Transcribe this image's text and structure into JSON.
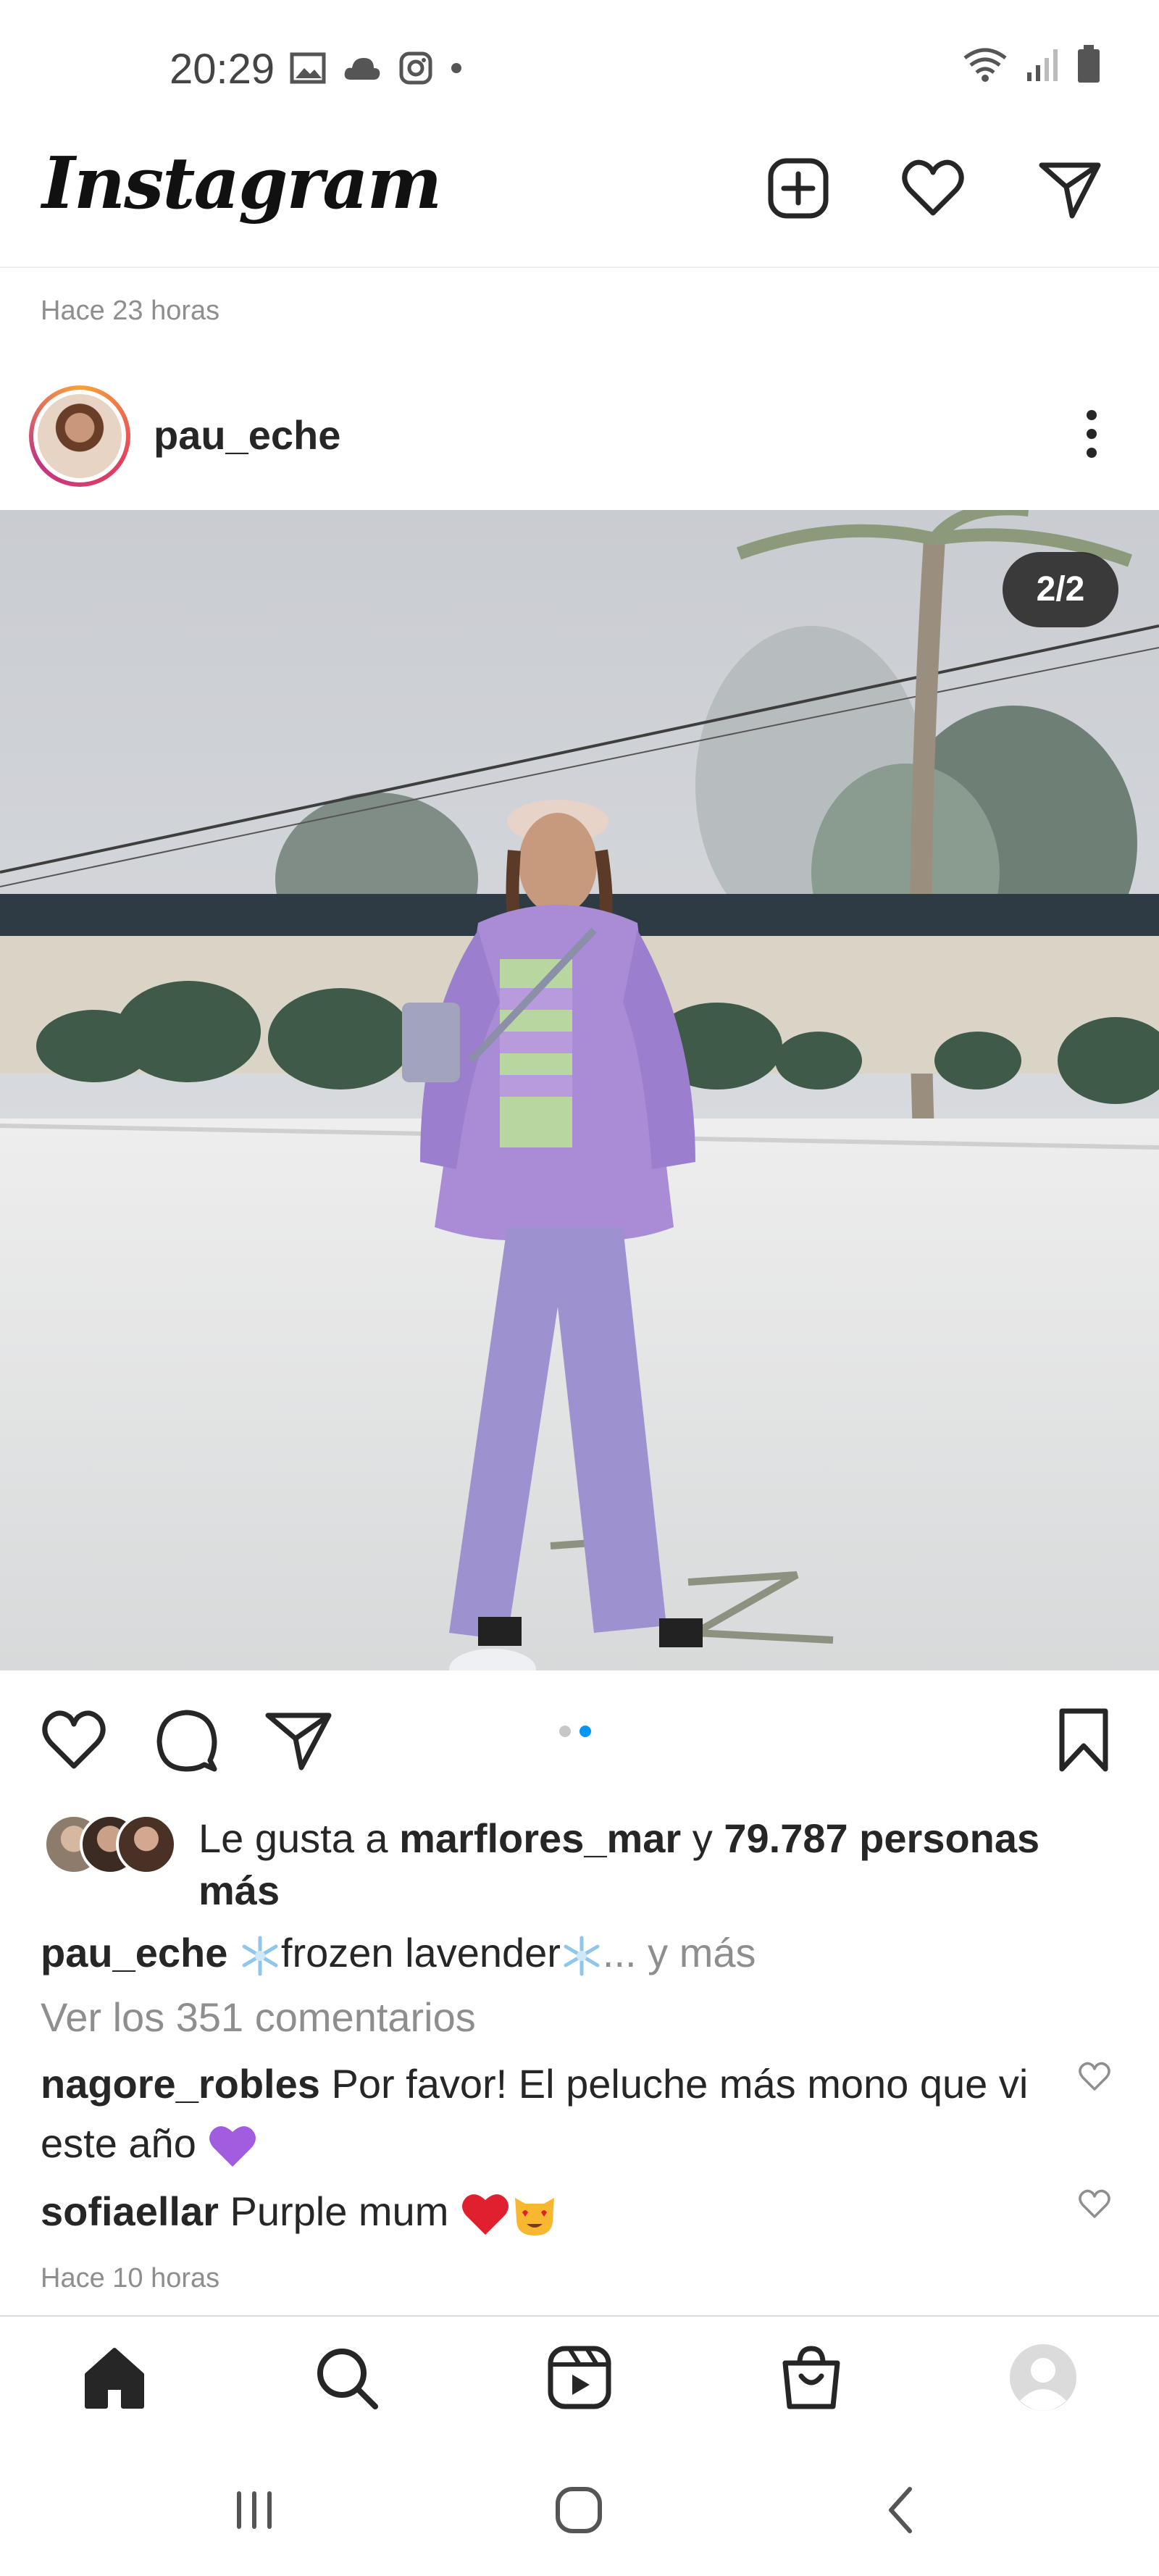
{
  "status_bar": {
    "time": "20:29"
  },
  "header": {
    "logo": "Instagram",
    "icons": [
      "new-post-icon",
      "heart-icon",
      "direct-icon"
    ]
  },
  "previous_post": {
    "time_ago": "Hace 23 horas"
  },
  "post": {
    "username": "pau_eche",
    "carousel_counter": "2/2",
    "carousel_index": 2,
    "carousel_total": 2,
    "likes": {
      "prefix": "Le gusta a ",
      "first_user": "marflores_mar",
      "connector": " y ",
      "others": "79.787 personas más"
    },
    "caption": {
      "username": "pau_eche",
      "text_before": "frozen lavender",
      "more": "... y más"
    },
    "view_comments": "Ver los 351 comentarios",
    "comments": [
      {
        "username": "nagore_robles",
        "text": " Por favor! El peluche más mono que vi este año"
      },
      {
        "username": "sofiaellar",
        "text": " Purple mum"
      }
    ],
    "time_ago": "Hace 10 horas"
  },
  "bottom_nav": {
    "items": [
      "home-icon",
      "search-icon",
      "reels-icon",
      "shop-icon",
      "profile-icon"
    ]
  },
  "colors": {
    "accent_blue": "#0095f6",
    "text": "#262626",
    "muted": "#8e8e8e",
    "coat": "#a98bd6"
  }
}
